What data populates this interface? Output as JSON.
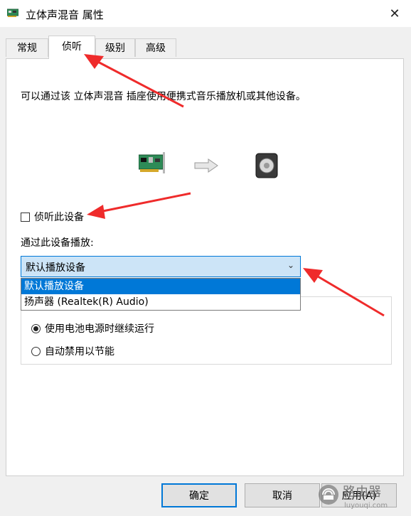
{
  "window": {
    "title": "立体声混音 属性",
    "close_label": "✕"
  },
  "tabs": [
    {
      "label": "常规",
      "active": false
    },
    {
      "label": "侦听",
      "active": true
    },
    {
      "label": "级别",
      "active": false
    },
    {
      "label": "高级",
      "active": false
    }
  ],
  "listen": {
    "description": "可以通过该 立体声混音 插座使用便携式音乐播放机或其他设备。",
    "listen_checkbox_label": "侦听此设备",
    "listen_checked": false,
    "playback_label": "通过此设备播放:",
    "dropdown_value": "默认播放设备",
    "dropdown_options": [
      {
        "label": "默认播放设备",
        "selected": true
      },
      {
        "label": "扬声器 (Realtek(R) Audio)",
        "selected": false
      }
    ],
    "power_options": [
      {
        "label": "使用电池电源时继续运行",
        "checked": true
      },
      {
        "label": "自动禁用以节能",
        "checked": false
      }
    ]
  },
  "buttons": {
    "ok": "确定",
    "cancel": "取消",
    "apply": "应用(A)"
  },
  "watermark": {
    "text": "路由器",
    "subtext": "luyouqi.com"
  },
  "colors": {
    "accent": "#0078d7",
    "annotation_arrow": "#ef2b2b",
    "dropdown_bg": "#cce4f7"
  },
  "icons": [
    "sound-card-icon",
    "right-arrow-icon",
    "speaker-icon",
    "close-icon",
    "chevron-down-icon"
  ]
}
